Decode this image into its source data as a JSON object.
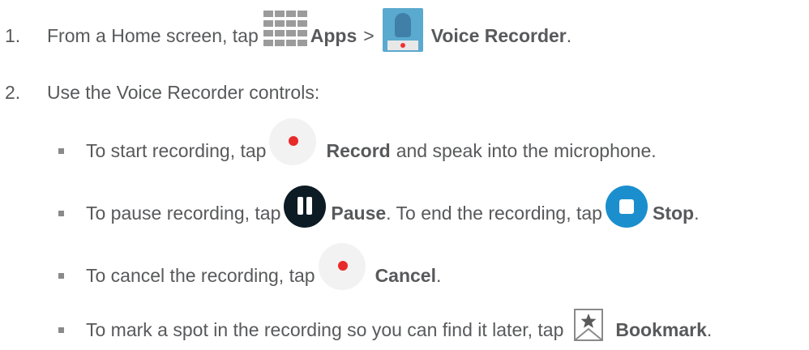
{
  "steps": [
    {
      "number": "1.",
      "prefix": "From a Home screen, tap",
      "apps_label": "Apps",
      "separator": ">",
      "recorder_label": "Voice Recorder",
      "suffix": "."
    },
    {
      "number": "2.",
      "text": "Use the Voice Recorder controls:"
    }
  ],
  "bullets": {
    "record": {
      "prefix": "To start recording, tap",
      "label": "Record",
      "suffix": "and speak into the microphone."
    },
    "pause": {
      "prefix": "To pause recording, tap",
      "label": "Pause",
      "middle": ". To end the recording, tap",
      "stop_label": "Stop",
      "suffix": "."
    },
    "cancel": {
      "prefix": "To cancel the recording, tap",
      "label": "Cancel",
      "suffix": "."
    },
    "bookmark": {
      "prefix": "To mark a spot in the recording so you can find it later, tap",
      "label": "Bookmark",
      "suffix": "."
    }
  },
  "icons": {
    "apps": "apps-grid-icon",
    "voice_recorder": "voice-recorder-app-icon",
    "record": "record-icon",
    "pause": "pause-icon",
    "stop": "stop-icon",
    "cancel": "cancel-icon",
    "bookmark": "bookmark-icon"
  },
  "colors": {
    "text": "#58595b",
    "record_dot": "#e82a2a",
    "pause_bg": "#0c1b24",
    "stop_bg": "#1b8fce",
    "recorder_bg": "#5aa9cf"
  }
}
